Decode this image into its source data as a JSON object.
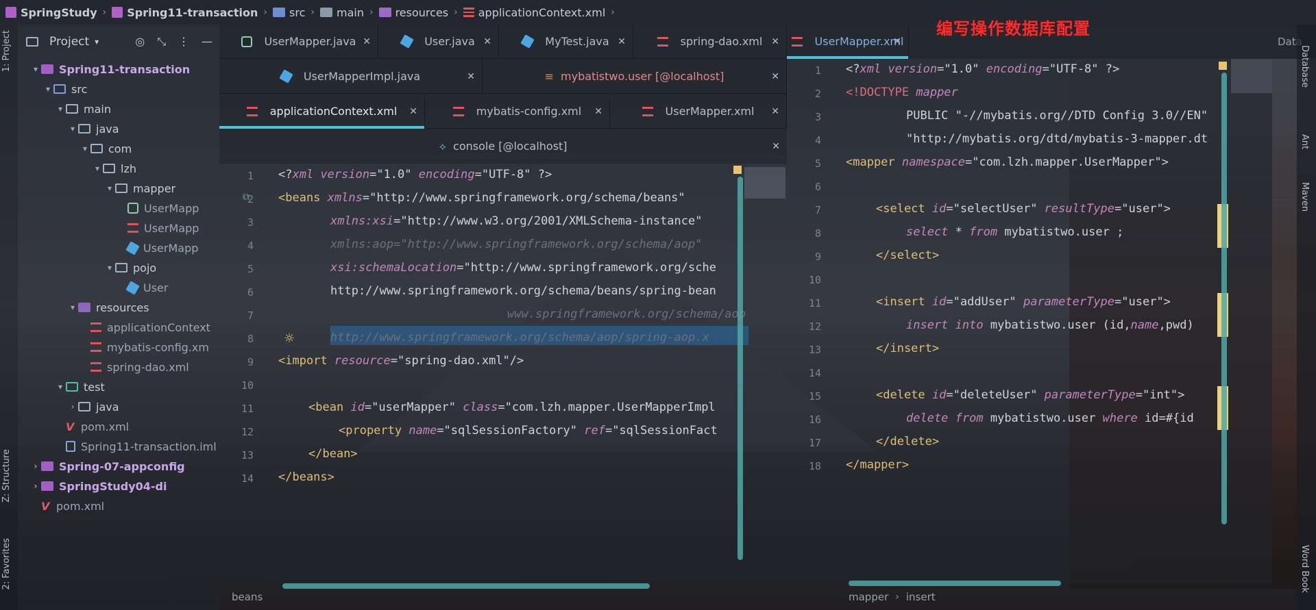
{
  "navbar": {
    "crumbs": [
      "SpringStudy",
      "Spring11-transaction",
      "src",
      "main",
      "resources",
      "applicationContext.xml"
    ]
  },
  "annotation": "编写操作数据库配置",
  "left_strip": {
    "project_tab": "1: Project",
    "structure_tab": "Z: Structure",
    "favorites_tab": "2: Favorites"
  },
  "right_strip": {
    "database_tab": "Database",
    "ant_tab": "Ant",
    "maven_tab": "Maven",
    "wordbook_tab": "Word Book"
  },
  "project_panel": {
    "title": "Project",
    "tree": [
      {
        "label": "Spring11-transaction"
      },
      {
        "label": "src"
      },
      {
        "label": "main"
      },
      {
        "label": "java"
      },
      {
        "label": "com"
      },
      {
        "label": "lzh"
      },
      {
        "label": "mapper"
      },
      {
        "label": "UserMapp"
      },
      {
        "label": "UserMapp"
      },
      {
        "label": "UserMapp"
      },
      {
        "label": "pojo"
      },
      {
        "label": "User"
      },
      {
        "label": "resources"
      },
      {
        "label": "applicationContext"
      },
      {
        "label": "mybatis-config.xm"
      },
      {
        "label": "spring-dao.xml"
      },
      {
        "label": "test"
      },
      {
        "label": "java"
      },
      {
        "label": "pom.xml"
      },
      {
        "label": "Spring11-transaction.iml"
      },
      {
        "label": "Spring-07-appconfig"
      },
      {
        "label": "SpringStudy04-di"
      },
      {
        "label": "pom.xml"
      }
    ]
  },
  "left_tabs": {
    "row1": [
      "UserMapper.java",
      "User.java",
      "MyTest.java",
      "spring-dao.xml"
    ],
    "row2": [
      "UserMapperImpl.java",
      "mybatistwo.user [@localhost]"
    ],
    "row3": [
      "applicationContext.xml",
      "mybatis-config.xml",
      "UserMapper.xml"
    ],
    "row4": [
      "console [@localhost]"
    ]
  },
  "right_tabs": {
    "active": "UserMapper.xml",
    "extra": "Data"
  },
  "editor_left": {
    "line_numbers": [
      "1",
      "2",
      "3",
      "4",
      "5",
      "6",
      "7",
      "8",
      "9",
      "10",
      "11",
      "12",
      "13",
      "14"
    ],
    "lines": [
      {
        "a": "<?",
        "b": "xml ",
        "c": "version",
        "d": "=\"1.0\" ",
        "e": "encoding",
        "f": "=\"UTF-8\" ?>"
      },
      {
        "a": "<beans ",
        "b": "xmlns",
        "c": "=\"http://www.springframework.org/schema/beans\""
      },
      {
        "a": "xmlns:",
        "b": "xsi",
        "c": "=\"http://www.w3.org/2001/XMLSchema-instance\""
      },
      {
        "a": "xmlns:aop=\"http://www.springframework.org/schema/aop\""
      },
      {
        "a": "xsi",
        "b": ":schemaLocation",
        "c": "=\"http://www.springframework.org/sche"
      },
      {
        "a": "http://www.springframework.org/schema/beans/spring-bean"
      },
      {
        "a": "www.springframework.org/schema/aop"
      },
      {
        "a": "http://www.springframework.org/schema/aop/spring-aop.x"
      },
      {
        "a": "<import ",
        "b": "resource",
        "c": "=\"spring-dao.xml\"/>"
      },
      {
        "a": ""
      },
      {
        "a": "<bean ",
        "b": "id",
        "c": "=\"userMapper\" ",
        "d": "class",
        "e": "=\"com.lzh.mapper.UserMapperImpl"
      },
      {
        "a": "<property ",
        "b": "name",
        "c": "=\"sqlSessionFactory\" ",
        "d": "ref",
        "e": "=\"sqlSessionFact"
      },
      {
        "a": "</bean>"
      },
      {
        "a": "</beans>"
      }
    ],
    "status": "beans"
  },
  "editor_right": {
    "line_numbers": [
      "1",
      "2",
      "3",
      "4",
      "5",
      "6",
      "7",
      "8",
      "9",
      "10",
      "11",
      "12",
      "13",
      "14",
      "15",
      "16",
      "17",
      "18"
    ],
    "lines": [
      {
        "a": "<?",
        "b": "xml ",
        "c": "version",
        "d": "=\"1.0\" ",
        "e": "encoding",
        "f": "=\"UTF-8\" ?>"
      },
      {
        "a": "<!DOCTYPE ",
        "b": "mapper"
      },
      {
        "a": "PUBLIC \"-//mybatis.org//DTD Config 3.0//EN\""
      },
      {
        "a": "\"http://mybatis.org/dtd/mybatis-3-mapper.dt"
      },
      {
        "a": "<mapper ",
        "b": "namespace",
        "c": "=\"com.lzh.mapper.UserMapper\">"
      },
      {
        "a": ""
      },
      {
        "a": "<select ",
        "b": "id",
        "c": "=\"selectUser\" ",
        "d": "resultType",
        "e": "=\"user\">"
      },
      {
        "a": "select ",
        "b": "* ",
        "c": "from ",
        "d": "mybatistwo.user ;"
      },
      {
        "a": "</select>"
      },
      {
        "a": ""
      },
      {
        "a": "<insert ",
        "b": "id",
        "c": "=\"addUser\" ",
        "d": "parameterType",
        "e": "=\"user\">"
      },
      {
        "a": "insert ",
        "b": "into ",
        "c": "mybatistwo.user (id,",
        "d": "name",
        "e": ",pwd)"
      },
      {
        "a": "</insert>"
      },
      {
        "a": ""
      },
      {
        "a": "<delete ",
        "b": "id",
        "c": "=\"deleteUser\" ",
        "d": "parameterType",
        "e": "=\"int\">"
      },
      {
        "a": "delete ",
        "b": "from ",
        "c": "mybatistwo.user ",
        "d": "where ",
        "e": "id=#{id"
      },
      {
        "a": "</delete>"
      },
      {
        "a": "</mapper>"
      }
    ],
    "status_crumbs": [
      "mapper",
      "insert"
    ]
  }
}
